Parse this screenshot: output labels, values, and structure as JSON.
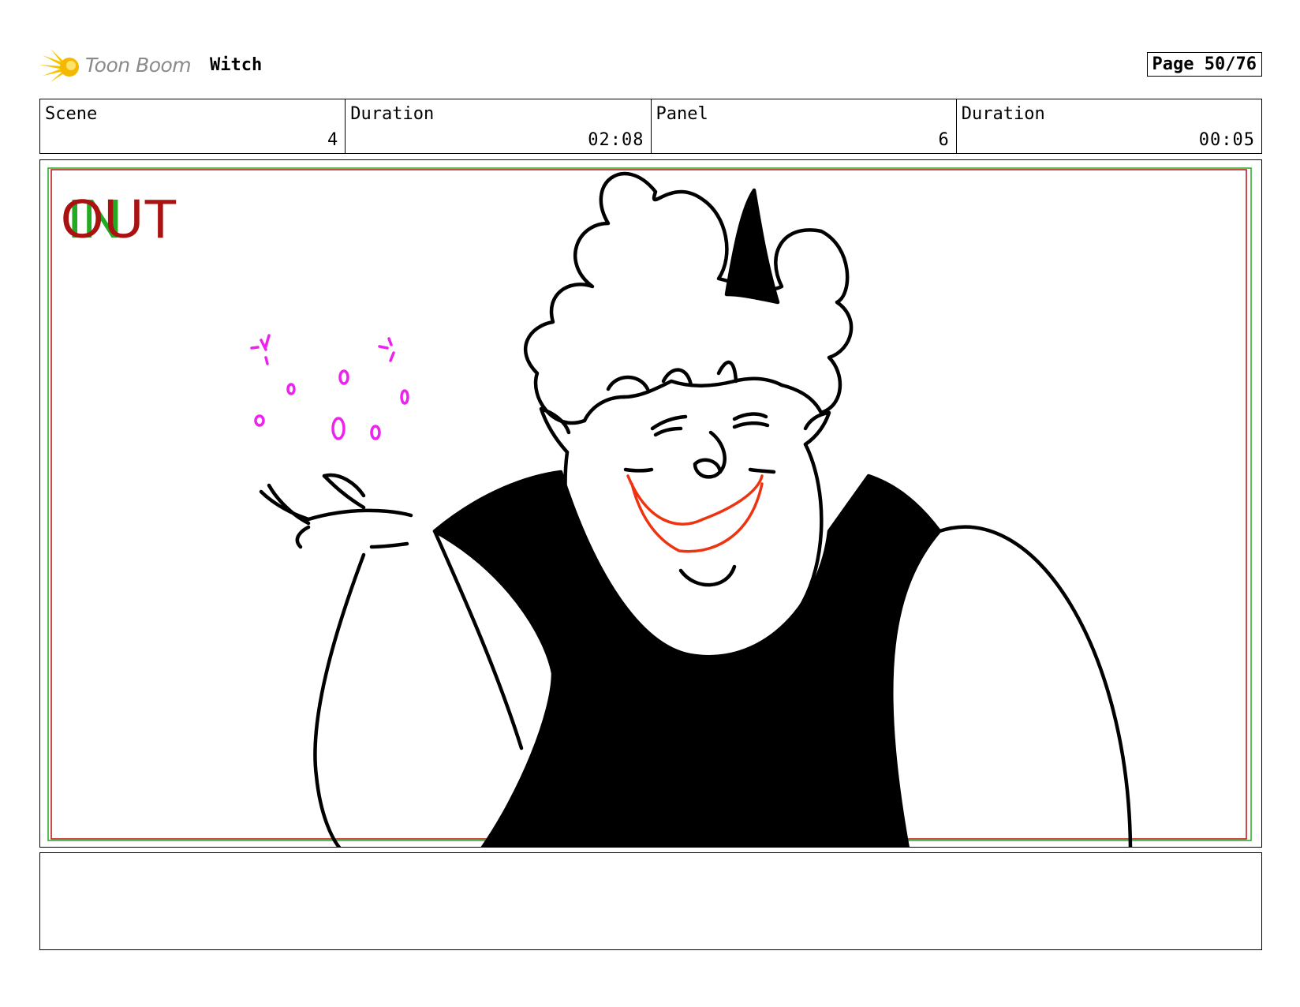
{
  "header": {
    "logo_text": "Toon Boom",
    "project_title": "Witch",
    "page_label": "Page 50/76"
  },
  "info": [
    {
      "label": "Scene",
      "value": "4"
    },
    {
      "label": "Duration",
      "value": "02:08"
    },
    {
      "label": "Panel",
      "value": "6"
    },
    {
      "label": "Duration",
      "value": "00:05"
    }
  ],
  "panel": {
    "in_marker": "IN",
    "out_marker": "OUT"
  },
  "colors": {
    "in_marker": "#22aa22",
    "out_marker": "#aa1111",
    "sparkles": "#ee22ee",
    "mouth": "#ee3311"
  },
  "notes": ""
}
